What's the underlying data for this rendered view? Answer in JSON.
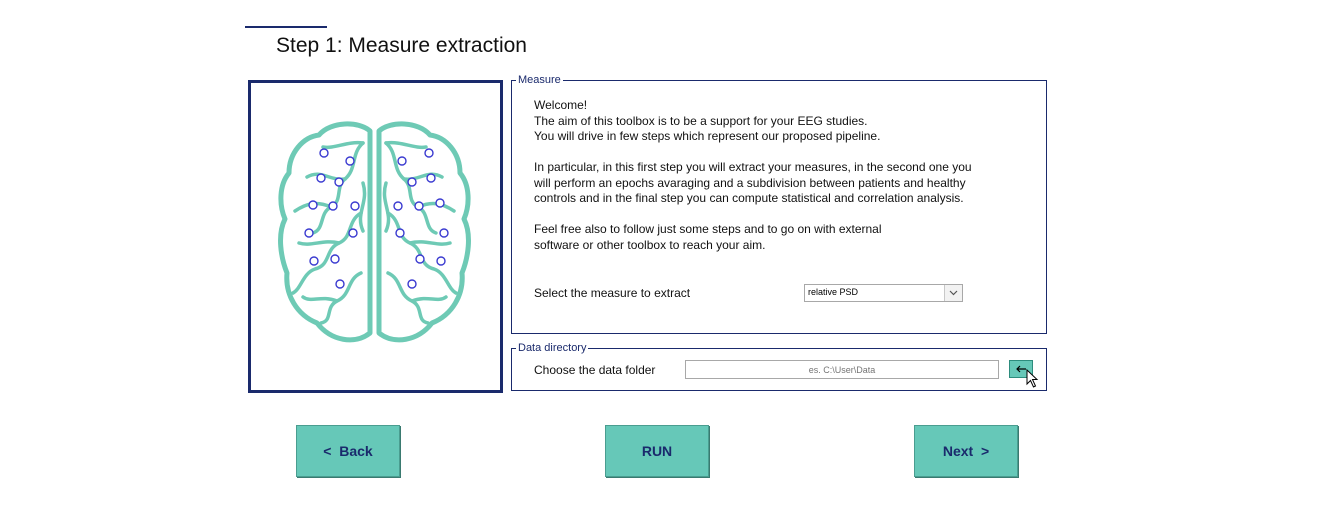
{
  "header": {
    "title": "Step 1: Measure extraction"
  },
  "measure": {
    "legend": "Measure",
    "intro": [
      [
        "Welcome!",
        "The aim of this toolbox is to be a support for your EEG studies.",
        "You will drive in few steps which represent our proposed pipeline."
      ],
      [
        "In particular, in this first step you will extract your measures, in the second one you",
        "will perform an epochs avaraging and a subdivision between patients and healthy",
        "controls and in the final step you can compute statistical and correlation analysis."
      ],
      [
        "Feel free also to follow just some steps and to go on with external",
        "software or other toolbox to reach your aim."
      ]
    ],
    "select_label": "Select the measure to extract",
    "select_value": "relative PSD"
  },
  "data_directory": {
    "legend": "Data directory",
    "label": "Choose the data folder",
    "placeholder": "es. C:\\User\\Data"
  },
  "buttons": {
    "back": "<  Back",
    "run": "RUN",
    "next": "Next  >"
  },
  "icons": {
    "browse": "arrow-left-icon",
    "cursor": "mouse-pointer-icon",
    "dropdown": "chevron-down-icon",
    "illustration": "brain-electrodes-image"
  },
  "colors": {
    "accent": "#66c8b8",
    "frame": "#1a2a6c",
    "brain": "#6ecab5",
    "electrode": "#3a3ad0"
  }
}
